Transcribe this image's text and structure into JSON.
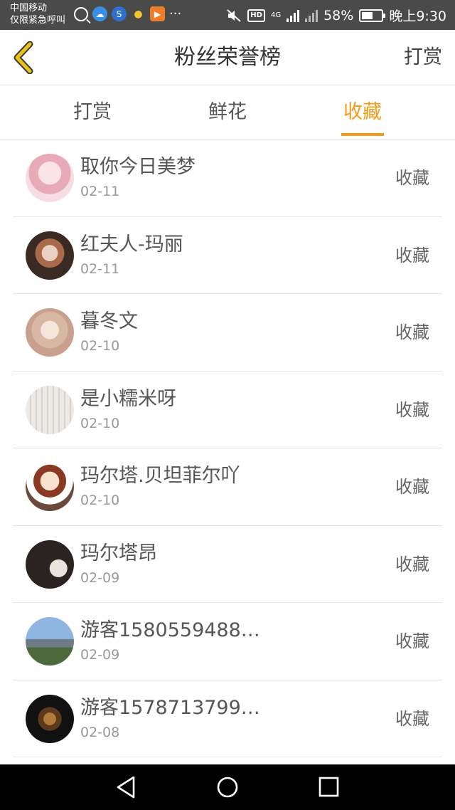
{
  "status_bar": {
    "carrier_line1": "中国移动",
    "carrier_line2": "仅限紧急呼叫",
    "more": "···",
    "hd": "HD",
    "network": "4G",
    "battery_percent": "58%",
    "battery_level": 0.58,
    "time": "晚上9:30"
  },
  "header": {
    "title": "粉丝荣誉榜",
    "right_action": "打赏"
  },
  "tabs": [
    {
      "label": "打赏",
      "active": false
    },
    {
      "label": "鲜花",
      "active": false
    },
    {
      "label": "收藏",
      "active": true
    }
  ],
  "fans": [
    {
      "name": "取你今日美梦",
      "date": "02-11",
      "action": "收藏"
    },
    {
      "name": "红夫人-玛丽",
      "date": "02-11",
      "action": "收藏"
    },
    {
      "name": "暮冬文",
      "date": "02-10",
      "action": "收藏"
    },
    {
      "name": "是小糯米呀",
      "date": "02-10",
      "action": "收藏"
    },
    {
      "name": "玛尔塔.贝坦菲尔吖",
      "date": "02-10",
      "action": "收藏"
    },
    {
      "name": "玛尔塔昂",
      "date": "02-09",
      "action": "收藏"
    },
    {
      "name": "游客1580559488…",
      "date": "02-09",
      "action": "收藏"
    },
    {
      "name": "游客1578713799…",
      "date": "02-08",
      "action": "收藏"
    }
  ],
  "colors": {
    "accent": "#f29c1c",
    "back_arrow": "#e8c21a"
  }
}
